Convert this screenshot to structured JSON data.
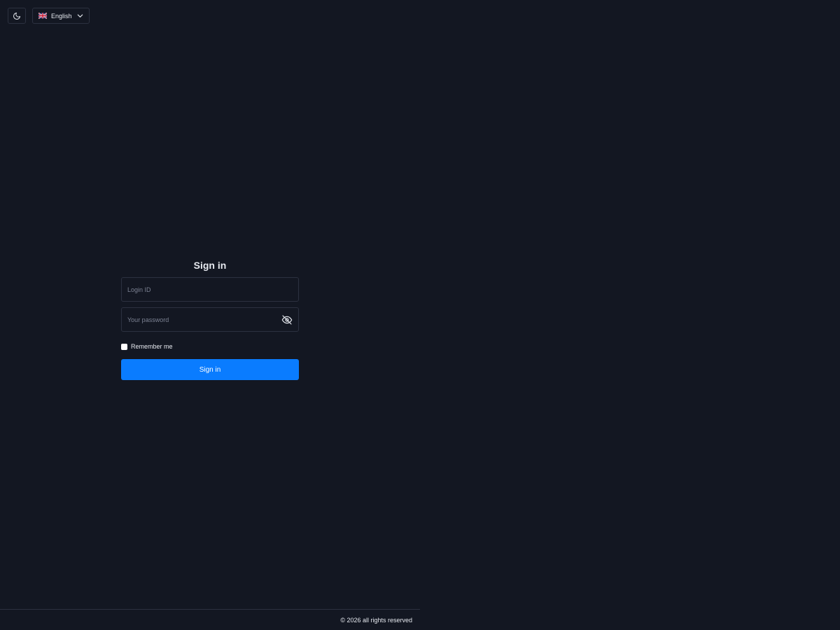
{
  "header": {
    "theme_toggle_icon": "moon-icon",
    "language": {
      "flag_icon": "uk-flag-icon",
      "selected": "English",
      "chevron_icon": "chevron-down-icon"
    }
  },
  "signin": {
    "title": "Sign in",
    "login_placeholder": "Login ID",
    "login_value": "",
    "password_placeholder": "Your password",
    "password_value": "",
    "password_toggle_icon": "eye-off-icon",
    "remember_label": "Remember me",
    "submit_label": "Sign in"
  },
  "footer": {
    "copyright": "© 2026 all rights reserved"
  },
  "colors": {
    "background": "#131722",
    "border": "#2c3140",
    "primary": "#0a7cff",
    "text": "#e6e9ef",
    "placeholder": "#7c8293"
  }
}
